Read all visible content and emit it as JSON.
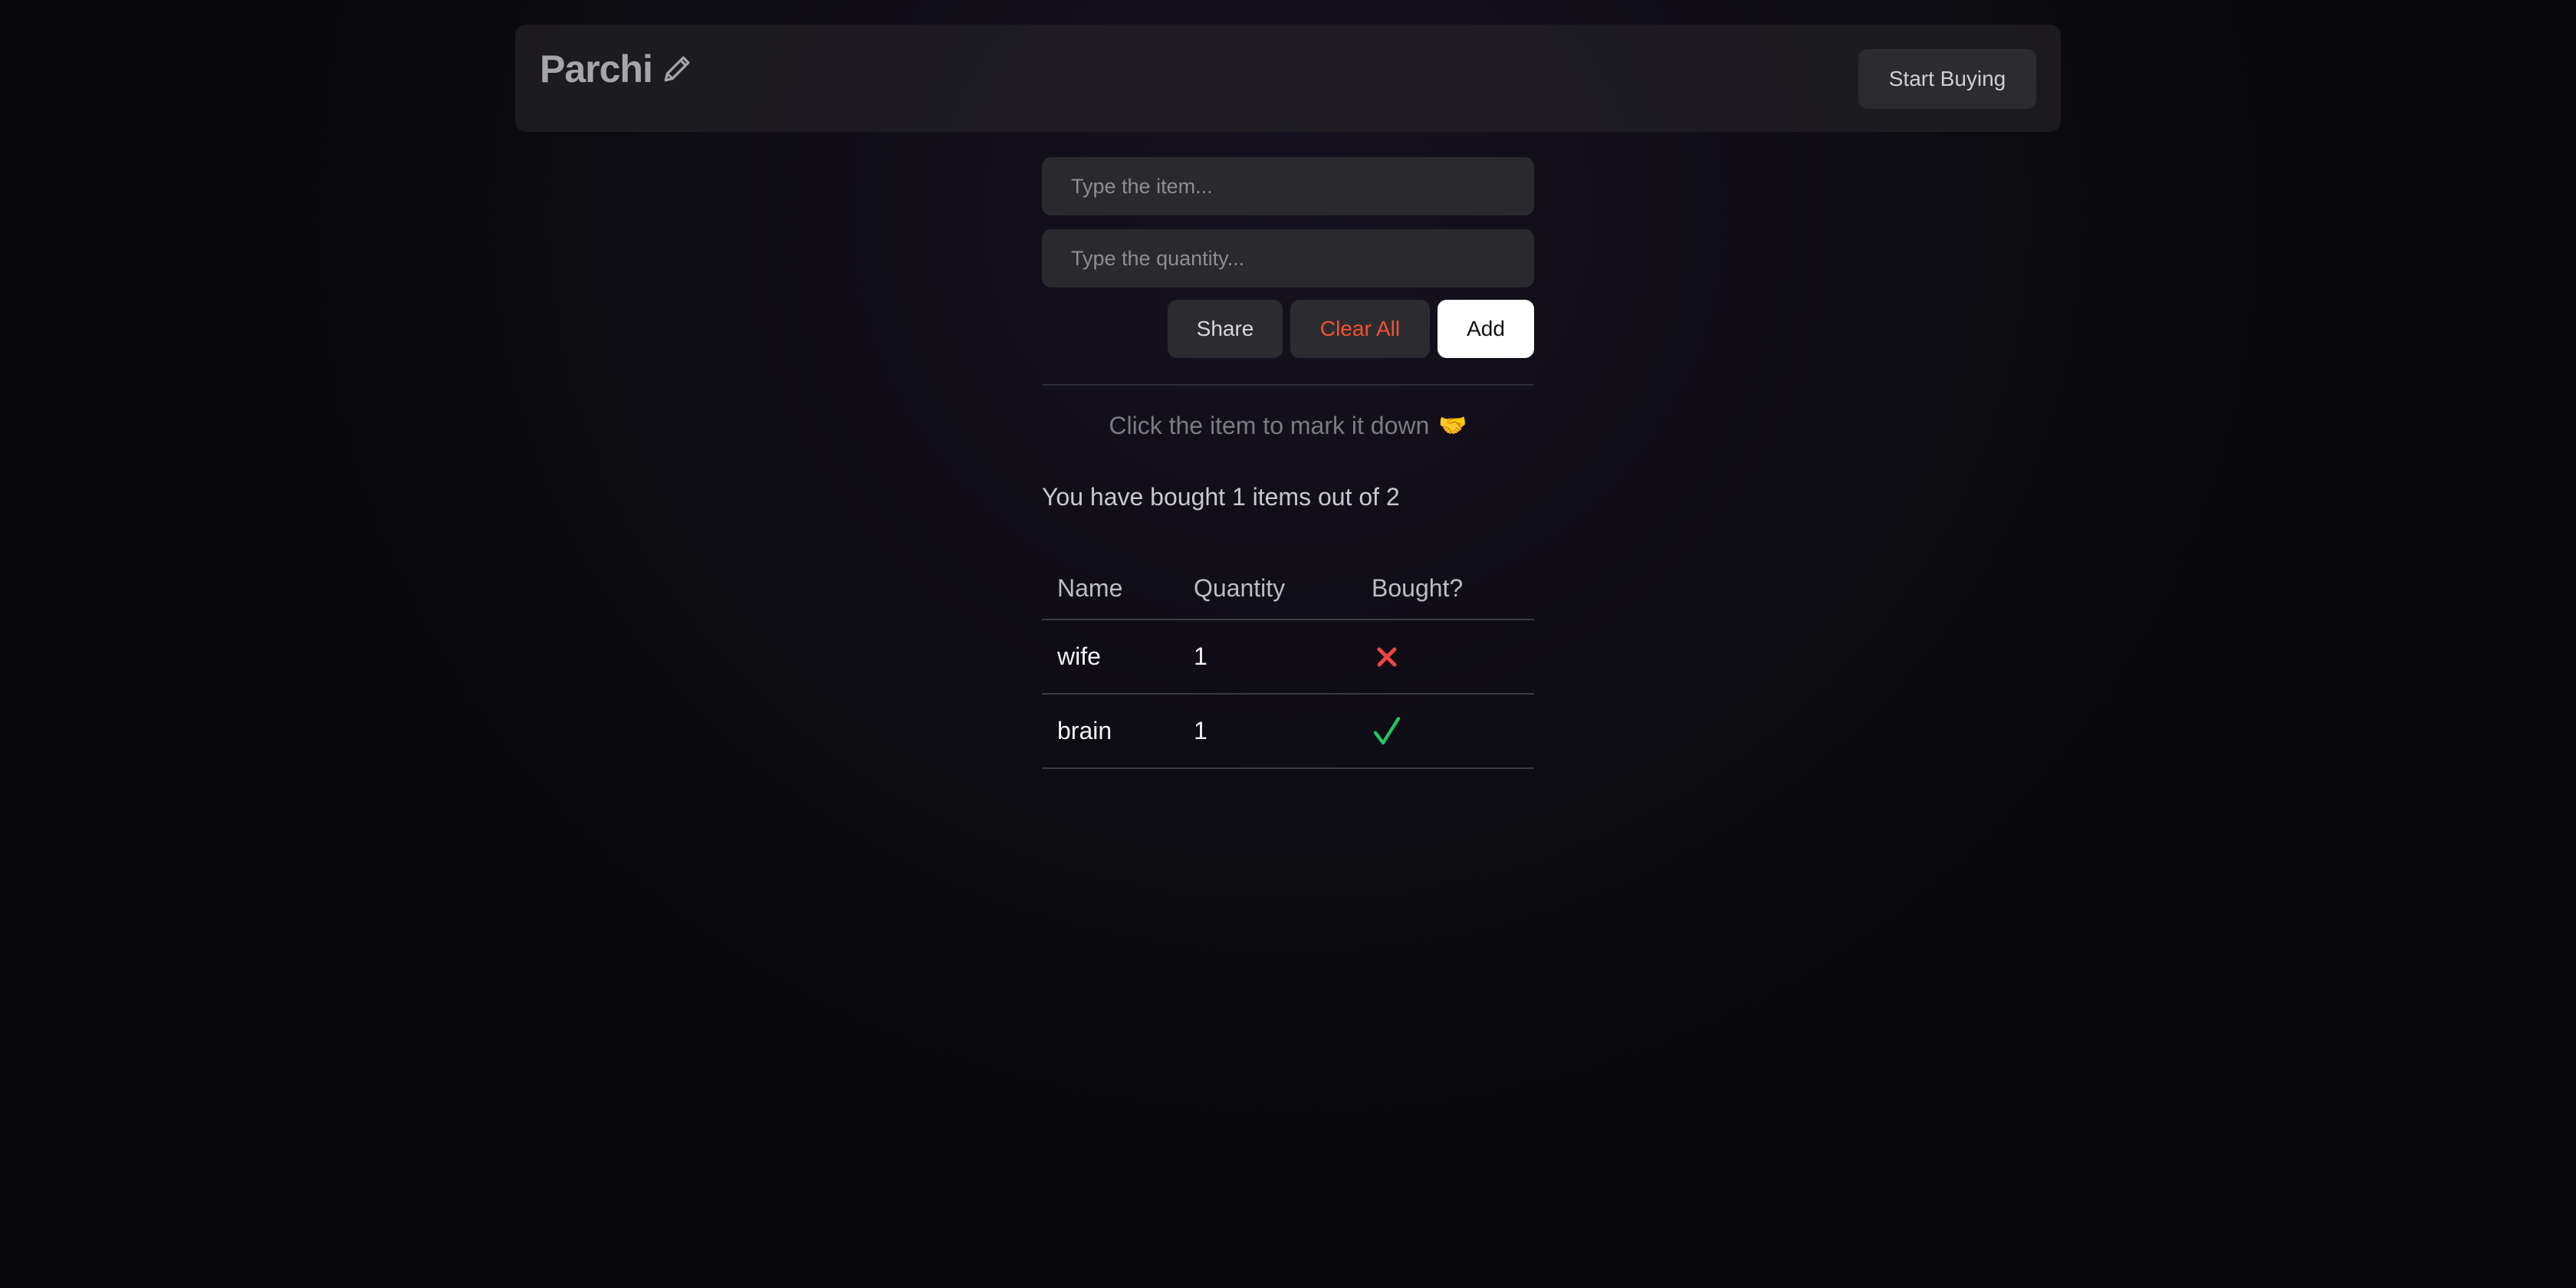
{
  "navbar": {
    "brand": "Parchi",
    "brand_icon": "pencil-icon",
    "start_buying_label": "Start Buying"
  },
  "form": {
    "item_placeholder": "Type the item...",
    "item_value": "",
    "quantity_placeholder": "Type the quantity...",
    "quantity_value": "",
    "share_label": "Share",
    "clear_all_label": "Clear All",
    "add_label": "Add"
  },
  "hint": {
    "text": "Click the item to mark it down",
    "icon": "handshake-icon"
  },
  "summary": "You have bought 1 items out of 2",
  "table": {
    "headers": {
      "name": "Name",
      "quantity": "Quantity",
      "bought": "Bought?"
    },
    "rows": [
      {
        "name": "wife",
        "quantity": "1",
        "bought": false,
        "bought_icon": "cross-icon"
      },
      {
        "name": "brain",
        "quantity": "1",
        "bought": true,
        "bought_icon": "check-icon"
      }
    ]
  },
  "colors": {
    "accent_danger": "#f4512f",
    "cross": "#ef4444",
    "check": "#22c55e",
    "primary_button": "#ffffff"
  }
}
